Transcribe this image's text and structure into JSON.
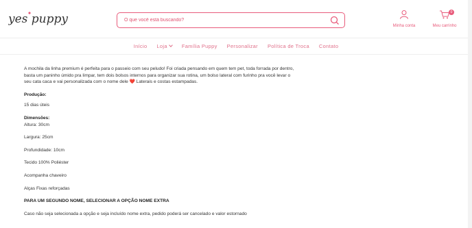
{
  "header": {
    "logo_text": "yes puppy",
    "search": {
      "placeholder": "O que você está buscando?"
    },
    "account_label": "Minha conta",
    "cart_label": "Meu carrinho",
    "cart_count": "0"
  },
  "nav": {
    "items": [
      "Início",
      "Loja",
      "Família Puppy",
      "Personalizar",
      "Política de Troca",
      "Contato"
    ]
  },
  "description": {
    "intro": "A mochila da linha premium é perfeita para o passeio com seu peludo! Foi criada pensando em quem tem pet, toda forrada por dentro, basta um paninho úmido pra limpar, tem dois bolsos internos para organizar sua rotina, um bolso lateral com furinho pra você levar o seu cata caca e vai personalizada com o nome dele",
    "intro_end": "Laterais e costas estampadas.",
    "heart": "❤️",
    "production_label": "Produção:",
    "production_value": "15 dias úteis",
    "dimensions_label": "Dimensões:",
    "height": "Altura: 30cm",
    "width": "Largura: 25cm",
    "depth": "Profundidade:  10cm",
    "fabric": "Tecido 100% Poliéster",
    "keychain": "Acompanha chaveiro",
    "straps": "Alças Fixas reforçadas",
    "second_name_heading": "PARA UM SEGUNDO NOME, SELECIONAR A OPÇÃO NOME EXTRA",
    "second_name_note": "Caso não seja selecionada a opção e seja incluído nome extra, pedido poderá ser cancelado e valor estornado"
  },
  "colors": {
    "accent": "#e85a7a",
    "nav": "#e0708a",
    "logo": "#333333"
  },
  "icons": {
    "search": "search-icon",
    "account": "user-icon",
    "cart": "cart-icon",
    "loja_dropdown": "chevron-down-icon"
  }
}
